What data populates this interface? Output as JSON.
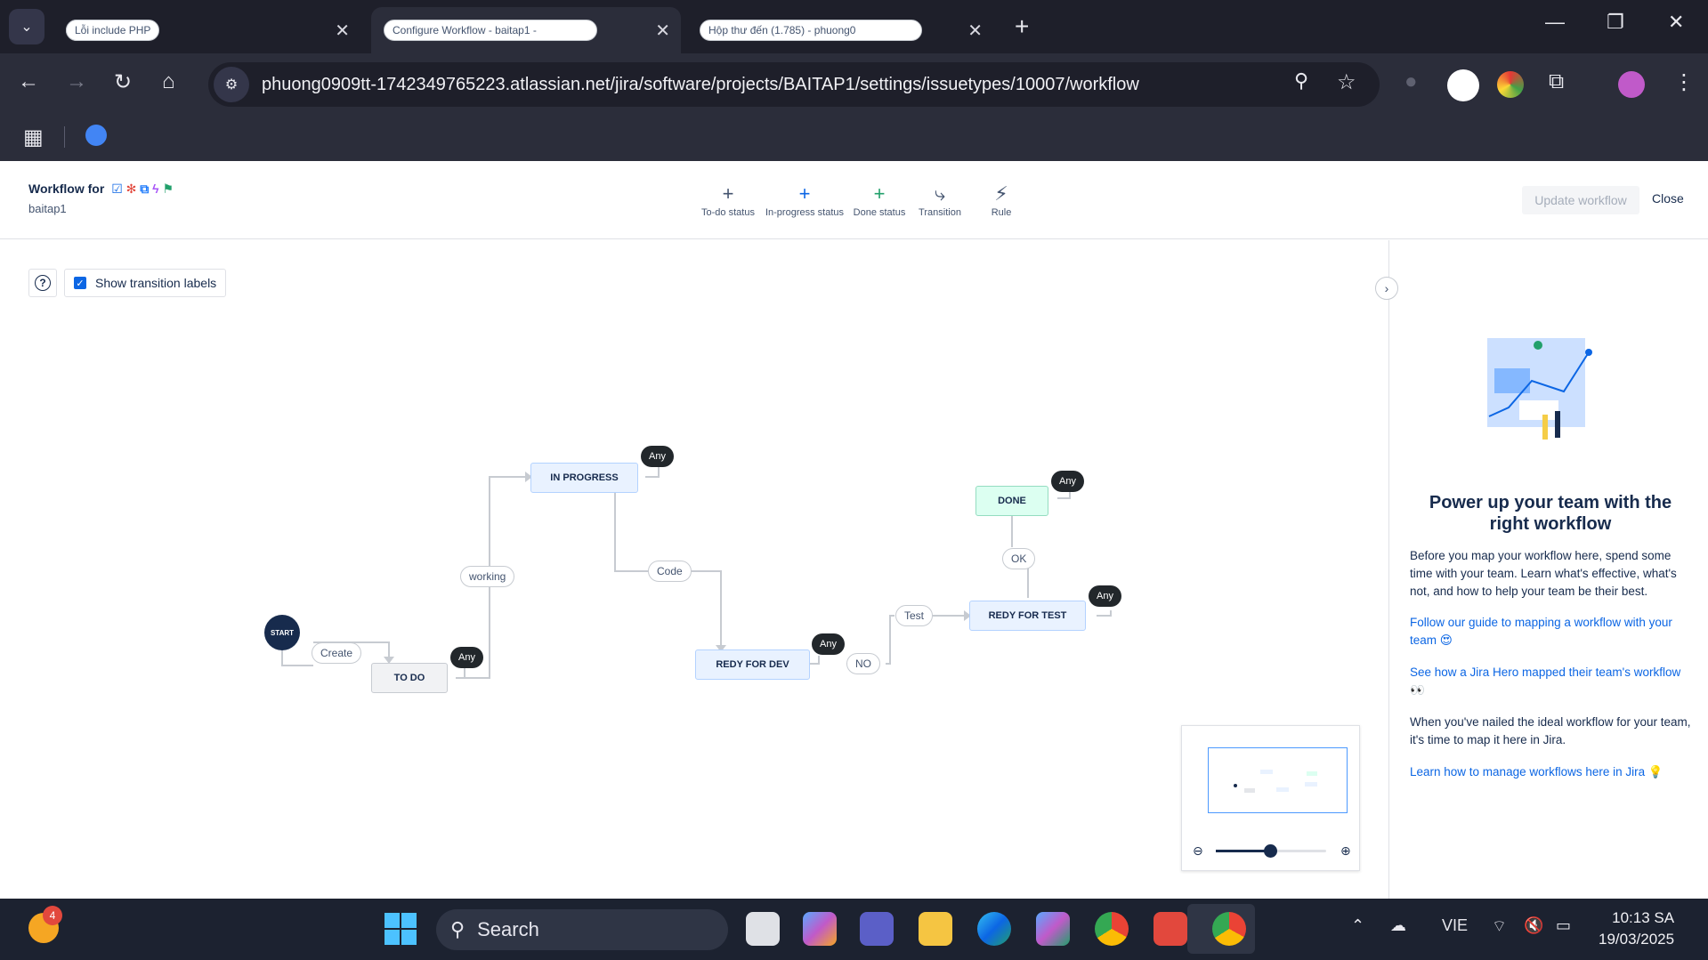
{
  "browser": {
    "tabs": [
      {
        "label": "Lỗi include PHP",
        "active": false
      },
      {
        "label": "Configure Workflow - baitap1 -",
        "active": true
      },
      {
        "label": "Hộp thư đến (1.785) - phuong0",
        "active": false
      }
    ],
    "url": "phuong0909tt-1742349765223.atlassian.net/jira/software/projects/BAITAP1/settings/issuetypes/10007/workflow"
  },
  "header": {
    "title": "Workflow for",
    "subtitle": "baitap1",
    "tools": [
      {
        "label": "To-do status",
        "glyph": "+"
      },
      {
        "label": "In-progress status",
        "glyph": "+"
      },
      {
        "label": "Done status",
        "glyph": "+"
      },
      {
        "label": "Transition",
        "glyph": "⤷"
      },
      {
        "label": "Rule",
        "glyph": "⚡"
      }
    ],
    "update_label": "Update workflow",
    "close_label": "Close"
  },
  "canvas": {
    "help_glyph": "?",
    "toggle_label": "Show transition labels",
    "toggle_checked": true,
    "start_label": "START",
    "statuses": {
      "todo": "TO DO",
      "in_progress": "IN PROGRESS",
      "redy_for_dev": "REDY FOR DEV",
      "redy_for_test": "REDY FOR TEST",
      "done": "DONE"
    },
    "transitions": {
      "create": "Create",
      "working": "working",
      "code": "Code",
      "no": "NO",
      "test": "Test",
      "ok": "OK"
    },
    "any_label": "Any"
  },
  "panel": {
    "title": "Power up your team with the right workflow",
    "intro": "Before you map your workflow here, spend some time with your team. Learn what's effective, what's not, and how to help your team be their best.",
    "link1": "Follow our guide to mapping a workflow with your team 😍",
    "link2": "See how a Jira Hero mapped their team's workflow 👀",
    "para2": "When you've nailed the ideal workflow for your team, it's time to map it here in Jira.",
    "link3": "Learn how to manage workflows here in Jira 💡"
  },
  "taskbar": {
    "search_label": "Search",
    "lang": "VIE",
    "time": "10:13 SA",
    "date": "19/03/2025",
    "notif_count": "4"
  },
  "colors": {
    "accent": "#0c66e4",
    "todo_bg": "#f1f2f4",
    "progress_bg": "#e9f2ff",
    "done_bg": "#dcfff1"
  }
}
